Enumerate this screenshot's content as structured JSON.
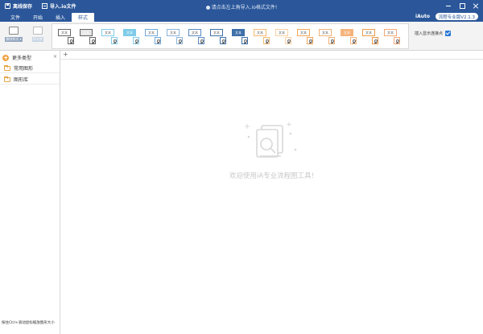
{
  "titlebar": {
    "offline_save": "离线保存",
    "import_file": "导入.io文件",
    "notice": "请点击左上角导入.io格式文件!"
  },
  "menu": {
    "items": [
      "文件",
      "开始",
      "插入",
      "样式"
    ],
    "active_index": 3,
    "brand": "iAuto",
    "version": "流程专业版V2.1.3"
  },
  "ribbon": {
    "buttons": [
      {
        "label": "删除样式 ▾",
        "icon": "style-delete-icon"
      },
      {
        "label": "样式库",
        "icon": "style-library-icon"
      }
    ],
    "styles": [
      {
        "label": "文本",
        "fill": "#ffffff",
        "stroke": "#666666"
      },
      {
        "label": "文本",
        "fill": "#e6e6e6",
        "stroke": "#666666"
      },
      {
        "label": "文本",
        "fill": "#ffffff",
        "stroke": "#7ecbe8"
      },
      {
        "label": "文本",
        "fill": "#7ecbe8",
        "stroke": "#7ecbe8"
      },
      {
        "label": "文本",
        "fill": "#ffffff",
        "stroke": "#6fa8dc"
      },
      {
        "label": "文本",
        "fill": "#ffffff",
        "stroke": "#8ab4d9"
      },
      {
        "label": "文本",
        "fill": "#ffffff",
        "stroke": "#5b8ac2"
      },
      {
        "label": "文本",
        "fill": "#ffffff",
        "stroke": "#3e6fa8"
      },
      {
        "label": "文本",
        "fill": "#3e6fa8",
        "stroke": "#3e6fa8"
      },
      {
        "label": "文本",
        "fill": "#ffffff",
        "stroke": "#f5b971"
      },
      {
        "label": "文本",
        "fill": "#ffffff",
        "stroke": "#f8d0a0"
      },
      {
        "label": "文本",
        "fill": "#ffffff",
        "stroke": "#f2a75b"
      },
      {
        "label": "文本",
        "fill": "#ffffff",
        "stroke": "#efb27a"
      },
      {
        "label": "文本",
        "fill": "#f6b47d",
        "stroke": "#f6b47d"
      },
      {
        "label": "文本",
        "fill": "#ffffff",
        "stroke": "#ec9a48"
      },
      {
        "label": "文本",
        "fill": "#ffffff",
        "stroke": "#f2a97a"
      }
    ],
    "option_label": "插入显示连接点",
    "option_checked": true
  },
  "sidebar": {
    "header": "更多类型",
    "items": [
      "常用图形",
      "图形库"
    ],
    "hint": "按住Ctrl+滚动鼠标缩放图形大小"
  },
  "canvas": {
    "welcome": "欢迎使用iA专业流程图工具!"
  },
  "colors": {
    "primary": "#2b579a",
    "accent_orange": "#f0a445",
    "checkbox": "#2b79d6"
  }
}
